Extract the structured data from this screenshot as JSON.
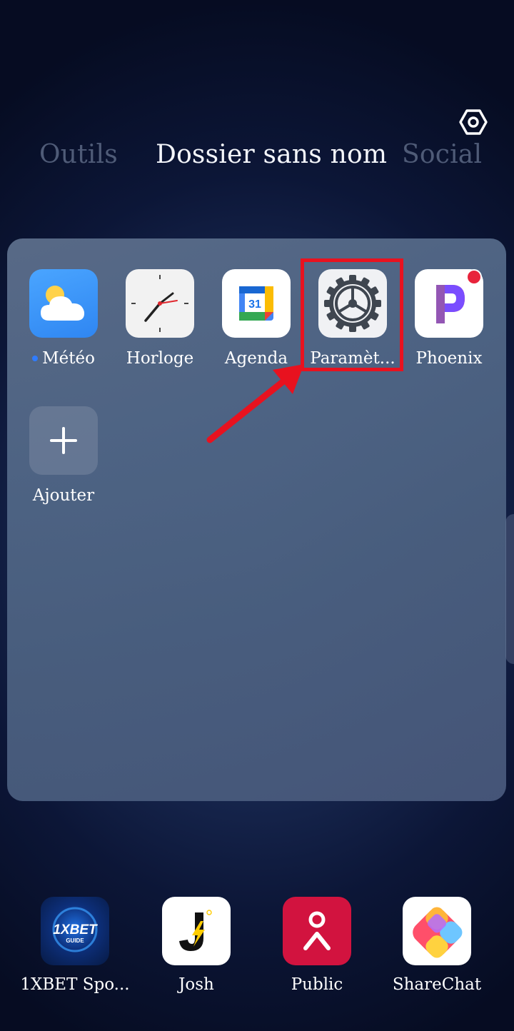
{
  "header": {
    "settings_icon": "hexagon-settings-icon"
  },
  "tabs": [
    {
      "label": "Outils",
      "active": false
    },
    {
      "label": "Dossier sans nom",
      "active": true
    },
    {
      "label": "Social",
      "active": false
    }
  ],
  "folder": {
    "apps": [
      {
        "label": "Météo",
        "icon": "weather-cloud-icon",
        "status_dot": true
      },
      {
        "label": "Horloge",
        "icon": "clock-icon"
      },
      {
        "label": "Agenda",
        "icon": "calendar-icon",
        "icon_text": "31"
      },
      {
        "label": "Paramèt...",
        "icon": "settings-gear-icon"
      },
      {
        "label": "Phoenix",
        "icon": "phoenix-icon",
        "notification": true
      }
    ],
    "add": {
      "label": "Ajouter",
      "icon": "plus-icon"
    }
  },
  "annotation": {
    "highlight_color": "#e8121f"
  },
  "dock": [
    {
      "label": "1XBET Spo...",
      "icon": "1xbet-icon",
      "icon_text": "1XBET",
      "icon_subtext": "GUIDE"
    },
    {
      "label": "Josh",
      "icon": "josh-icon"
    },
    {
      "label": "Public",
      "icon": "public-icon"
    },
    {
      "label": "ShareChat",
      "icon": "sharechat-icon"
    }
  ]
}
